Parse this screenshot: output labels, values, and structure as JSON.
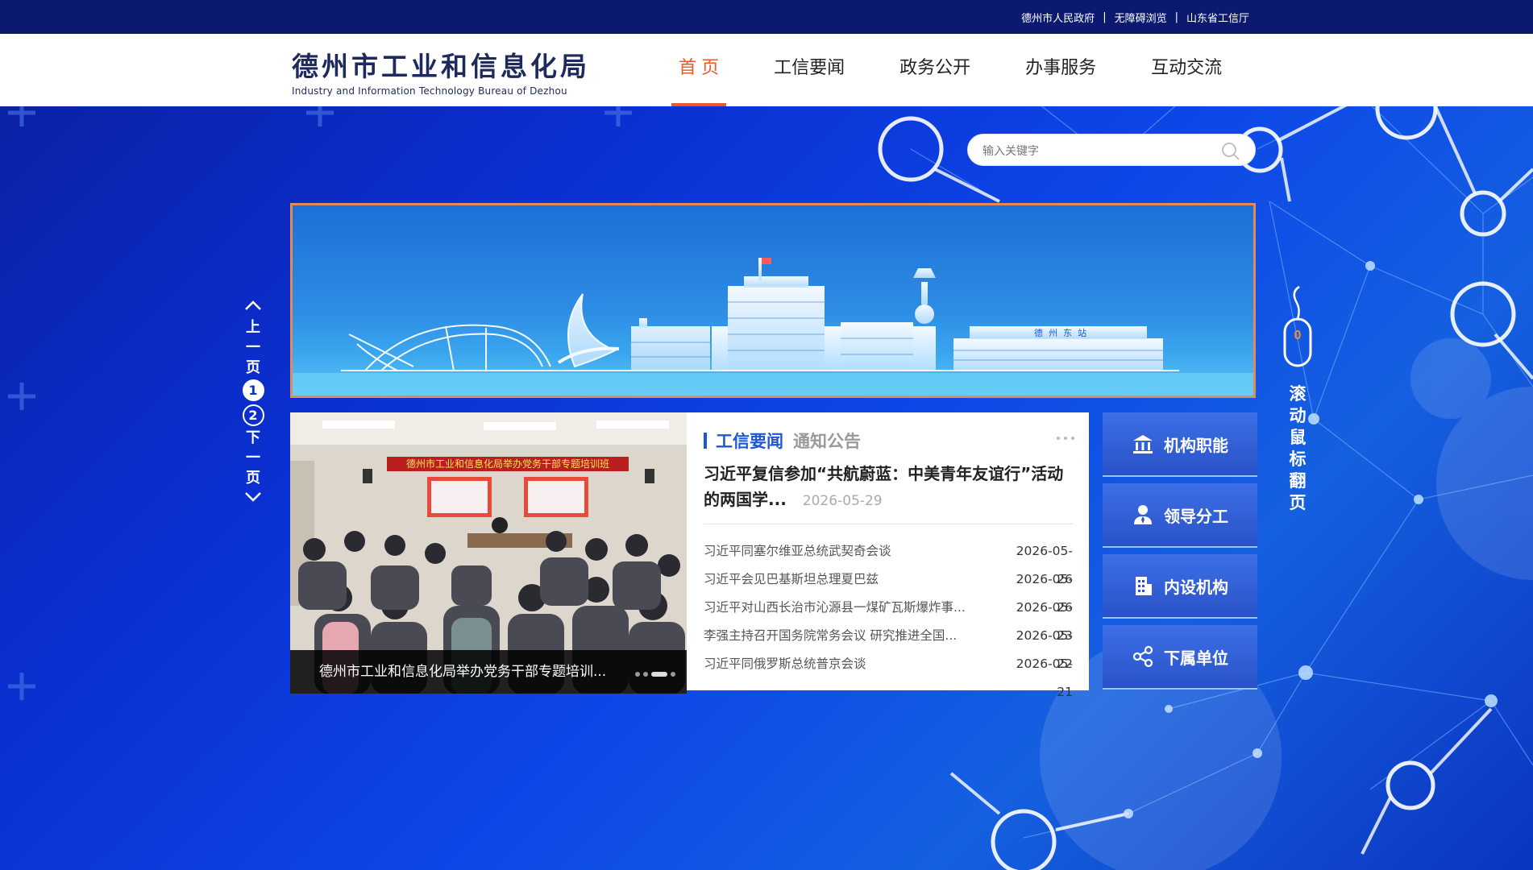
{
  "top_links": [
    {
      "label": "德州市人民政府"
    },
    {
      "label": "无障碍浏览"
    },
    {
      "label": "山东省工信厅"
    }
  ],
  "logo": {
    "cn": "德州市工业和信息化局",
    "en": "Industry and Information Technology Bureau of Dezhou"
  },
  "nav": [
    {
      "label": "首 页",
      "active": true
    },
    {
      "label": "工信要闻"
    },
    {
      "label": "政务公开"
    },
    {
      "label": "办事服务"
    },
    {
      "label": "互动交流"
    }
  ],
  "search": {
    "placeholder": "输入关键字",
    "icon": "search-icon"
  },
  "banner": {
    "sign_text": "德 州 东 站"
  },
  "pager": {
    "prev_label": [
      "上",
      "一",
      "页"
    ],
    "pages": [
      "1",
      "2"
    ],
    "current_page": "1",
    "next_label": [
      "下",
      "一",
      "页"
    ]
  },
  "photo": {
    "banner_text": "德州市工业和信息化局举办党务干部专题培训班",
    "caption": "德州市工业和信息化局举办党务干部专题培训...",
    "slide_count": 4,
    "active_slide": 3
  },
  "news": {
    "tabs": [
      {
        "label": "工信要闻",
        "active": true
      },
      {
        "label": "通知公告"
      }
    ],
    "headline": {
      "title": "习近平复信参加“共航蔚蓝：中美青年友谊行”活动的两国学...",
      "date": "2026-05-29"
    },
    "items": [
      {
        "title": "习近平同塞尔维亚总统武契奇会谈",
        "date": "2026-05-26"
      },
      {
        "title": "习近平会见巴基斯坦总理夏巴兹",
        "date": "2026-05-26"
      },
      {
        "title": "习近平对山西长治市沁源县一煤矿瓦斯爆炸事...",
        "date": "2026-05-23"
      },
      {
        "title": "李强主持召开国务院常务会议 研究推进全国...",
        "date": "2026-05-22"
      },
      {
        "title": "习近平同俄罗斯总统普京会谈",
        "date": "2026-05-21"
      }
    ]
  },
  "quick_links": [
    {
      "label": "机构职能",
      "icon": "institution-icon"
    },
    {
      "label": "领导分工",
      "icon": "leader-icon"
    },
    {
      "label": "内设机构",
      "icon": "building-icon"
    },
    {
      "label": "下属单位",
      "icon": "share-icon"
    }
  ],
  "scroll_hint": {
    "text": [
      "滚",
      "动",
      "鼠",
      "标",
      "翻",
      "页"
    ],
    "mouse_digit": "0"
  },
  "colors": {
    "accent": "#e8592b",
    "primary_blue": "#1c58d6",
    "topbar": "#0b1a6e",
    "background": "#0b2fd0"
  }
}
